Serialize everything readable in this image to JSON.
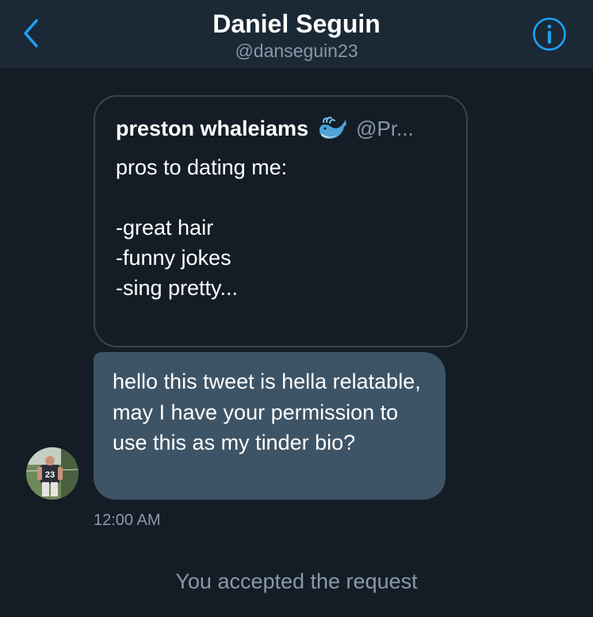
{
  "header": {
    "title": "Daniel Seguin",
    "handle": "@danseguin23",
    "back_icon": "chevron-left-icon",
    "info_icon": "info-icon"
  },
  "colors": {
    "background": "#141d26",
    "header_background": "#1b2836",
    "accent": "#1da1f2",
    "bubble": "#3d5466",
    "muted_text": "#8899a6",
    "border": "#38444d"
  },
  "quoted_tweet": {
    "display_name": "preston whaleiams",
    "emoji": "spouting-whale-emoji",
    "username": "@Pr...",
    "text_lines": [
      "pros to dating me:",
      "",
      "-great hair",
      "-funny jokes",
      "-sing pretty..."
    ]
  },
  "message": {
    "text": "hello this tweet is hella relatable, may I have your permission to use this as my tinder bio?",
    "timestamp": "12:00 AM",
    "avatar_number": "23"
  },
  "system_message": "You accepted the request"
}
